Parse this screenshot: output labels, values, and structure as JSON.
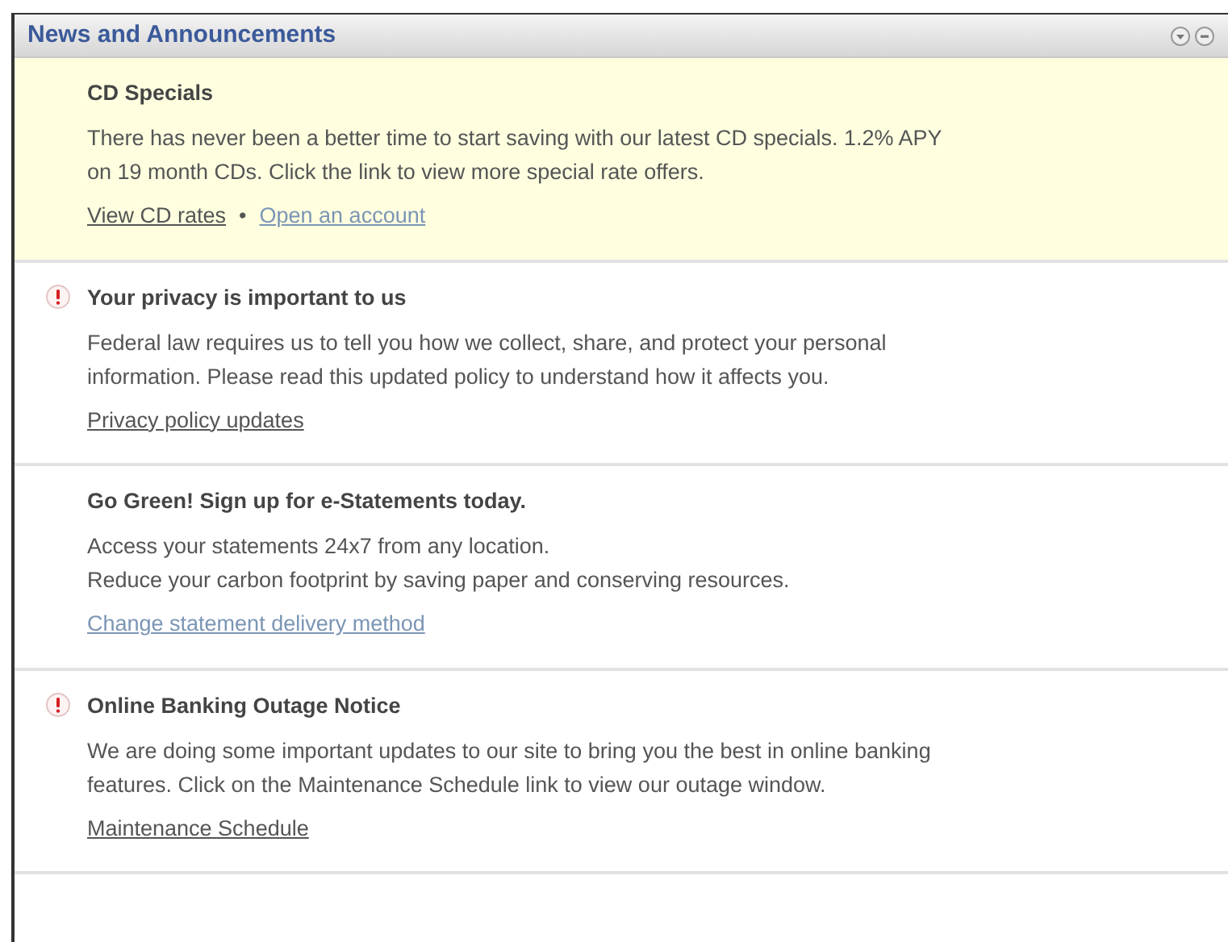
{
  "panel": {
    "title": "News and Announcements"
  },
  "items": [
    {
      "title": "CD Specials",
      "alert": false,
      "highlighted": true,
      "lines": [
        "There has never been a better time to start saving with our latest CD specials. 1.2% APY",
        "on 19 month CDs. Click the link to view more special rate offers."
      ],
      "links": [
        {
          "label": "View CD rates",
          "visited": false
        },
        {
          "label": "Open an account",
          "visited": true
        }
      ],
      "separator": "•"
    },
    {
      "title": "Your privacy is important to us",
      "alert": true,
      "highlighted": false,
      "lines": [
        "Federal law requires us to tell you how we collect, share, and protect your personal",
        "information. Please read this updated policy to understand how it affects you."
      ],
      "links": [
        {
          "label": "Privacy policy updates",
          "visited": false
        }
      ]
    },
    {
      "title": "Go Green! Sign up for e-Statements today.",
      "alert": false,
      "highlighted": false,
      "lines": [
        "Access your statements 24x7 from any location.",
        "Reduce your carbon footprint by saving paper and conserving resources."
      ],
      "links": [
        {
          "label": "Change statement delivery method",
          "visited": true
        }
      ]
    },
    {
      "title": "Online Banking Outage Notice",
      "alert": true,
      "highlighted": false,
      "lines": [
        "We are doing some important updates to our site to bring you the best in online banking",
        "features. Click on the Maintenance Schedule link to view our outage window."
      ],
      "links": [
        {
          "label": "Maintenance Schedule",
          "visited": false
        }
      ]
    }
  ]
}
